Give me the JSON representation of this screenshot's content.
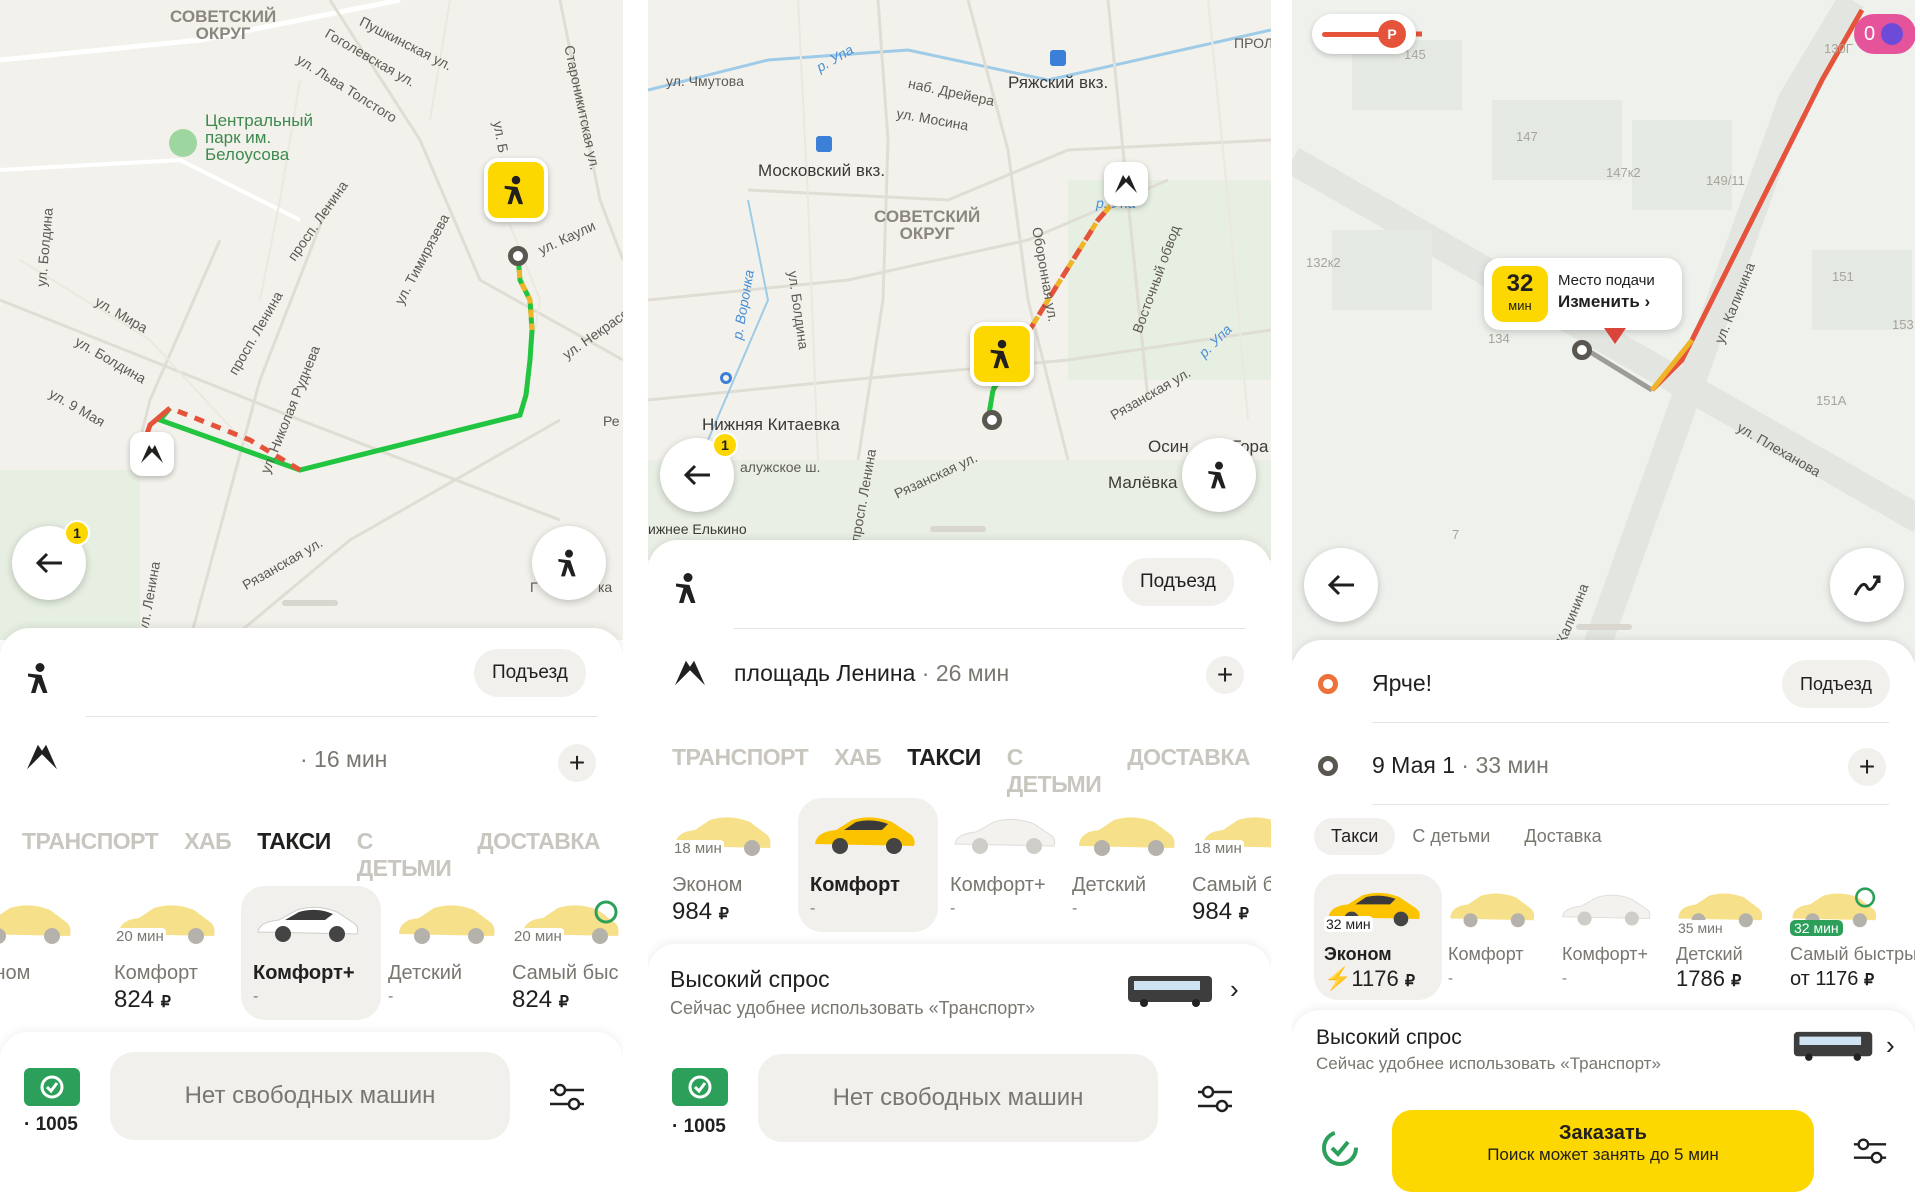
{
  "colors": {
    "accent": "#fcd700",
    "route_green": "#21c53f",
    "traffic_red": "#e5543a",
    "traffic_yellow": "#f0b429",
    "cashback_green": "#2ca05a",
    "map_bg": "#f3f1eb"
  },
  "panel1": {
    "map_labels": {
      "district": "СОВЕТСКИЙ\nОКРУГ",
      "park": "Центральный\nпарк им.\nБелоусова",
      "s1": "Пушкинская ул.",
      "s2": "Гоголевская ул.",
      "s3": "ул. Льва Толстого",
      "s4": "Староникитская ул.",
      "s5": "ул. Каули",
      "s6": "ул. Некрасова",
      "s7": "ул. Тимирязева",
      "s8": "просп. Ленина",
      "s9": "ул. Болдина",
      "s10": "ул. Мира",
      "s11": "ул. Болдина",
      "s12": "ул. 9 Мая",
      "s13": "ул. Николая Руднева",
      "s14": "Рязанская ул.",
      "s15": "ул. Ленина",
      "s16": "просп. Ленина",
      "s17": "ул. Б",
      "s18": "Г",
      "s19": "ка",
      "s20": "Ре"
    },
    "badge": "1",
    "from_pickup": "Подъезд",
    "to_time": "· 16 мин",
    "tabs": [
      "ТРАНСПОРТ",
      "ХАБ",
      "ТАКСИ",
      "С ДЕТЬМИ",
      "ДОСТАВКА"
    ],
    "active_tab": "ТАКСИ",
    "tariffs": [
      {
        "name": "Эконом",
        "price": "",
        "eta": ""
      },
      {
        "name": "Комфорт",
        "price": "824",
        "eta": "20 мин"
      },
      {
        "name": "Комфорт+",
        "price": "-",
        "eta": ""
      },
      {
        "name": "Детский",
        "price": "-",
        "eta": ""
      },
      {
        "name": "Самый быс",
        "price": "824",
        "eta": "20 мин"
      }
    ],
    "currency": "₽",
    "balance": "1005",
    "no_cars": "Нет свободных машин"
  },
  "panel2": {
    "map_labels": {
      "district": "СОВЕТСКИЙ\nОКРУГ",
      "station1": "Московский вкз.",
      "station2": "Ряжский вкз.",
      "place1": "Нижняя Китаевка",
      "place2": "Малёвка",
      "place3": "Осин",
      "place4": "Гора",
      "place5": "ижнее Елькино",
      "place6": "ПРОЛ",
      "s1": "ул. Чмутова",
      "s2": "наб. Дрейера",
      "s3": "ул. Мосина",
      "s4": "р. Упа",
      "s5": "р. Упа",
      "s6": "Оборонная ул.",
      "s7": "Восточный обвод",
      "s8": "ул. Болдина",
      "s9": "р. Воронка",
      "s10": "Рязанская ул.",
      "s11": "Рязанская ул.",
      "s12": "алужское ш.",
      "s13": "просп. Ленина",
      "s14": "р. Упа"
    },
    "badge": "1",
    "from_pickup": "Подъезд",
    "to_name": "площадь Ленина",
    "to_time": "· 26 мин",
    "tabs": [
      "ТРАНСПОРТ",
      "ХАБ",
      "ТАКСИ",
      "С ДЕТЬМИ",
      "ДОСТАВКА"
    ],
    "active_tab": "ТАКСИ",
    "tariffs": [
      {
        "name": "Эконом",
        "price": "984",
        "eta": "18 мин"
      },
      {
        "name": "Комфорт",
        "price": "-",
        "eta": ""
      },
      {
        "name": "Комфорт+",
        "price": "-",
        "eta": ""
      },
      {
        "name": "Детский",
        "price": "-",
        "eta": ""
      },
      {
        "name": "Самый б",
        "price": "984",
        "eta": "18 мин"
      }
    ],
    "currency": "₽",
    "demand_title": "Высокий спрос",
    "demand_text": "Сейчас удобнее использовать «Транспорт»",
    "balance": "1005",
    "no_cars": "Нет свободных машин"
  },
  "panel3": {
    "map_labels": {
      "n1": "145",
      "n2": "147",
      "n3": "147к2",
      "n4": "149/11",
      "n5": "130Г",
      "n6": "132к2",
      "n7": "134",
      "n8": "151",
      "n9": "153",
      "n10": "151А",
      "n11": "7",
      "s1": "ул. Калинина",
      "s2": "ул. Плеханова",
      "s3": "Калинина"
    },
    "pickup_minutes": "32",
    "pickup_minutes_unit": "мин",
    "pickup_title": "Место подачи",
    "pickup_change": "Изменить ›",
    "top_counter": "0",
    "from_name": "Ярче!",
    "from_pickup": "Подъезд",
    "to_name": "9 Мая 1",
    "to_time": "· 33 мин",
    "tabs": [
      "Такси",
      "С детьми",
      "Доставка"
    ],
    "active_tab": "Такси",
    "tariffs": [
      {
        "name": "Эконом",
        "price": "1176",
        "eta": "32 мин"
      },
      {
        "name": "Комфорт",
        "price": "-",
        "eta": ""
      },
      {
        "name": "Комфорт+",
        "price": "-",
        "eta": ""
      },
      {
        "name": "Детский",
        "price": "1786",
        "eta": "35 мин"
      },
      {
        "name": "Самый быстры",
        "price": "от 1176",
        "eta": "32 мин"
      }
    ],
    "currency": "₽",
    "demand_title": "Высокий спрос",
    "demand_text": "Сейчас удобнее использовать «Транспорт»",
    "order_title": "Заказать",
    "order_sub": "Поиск может занять до 5 мин"
  }
}
